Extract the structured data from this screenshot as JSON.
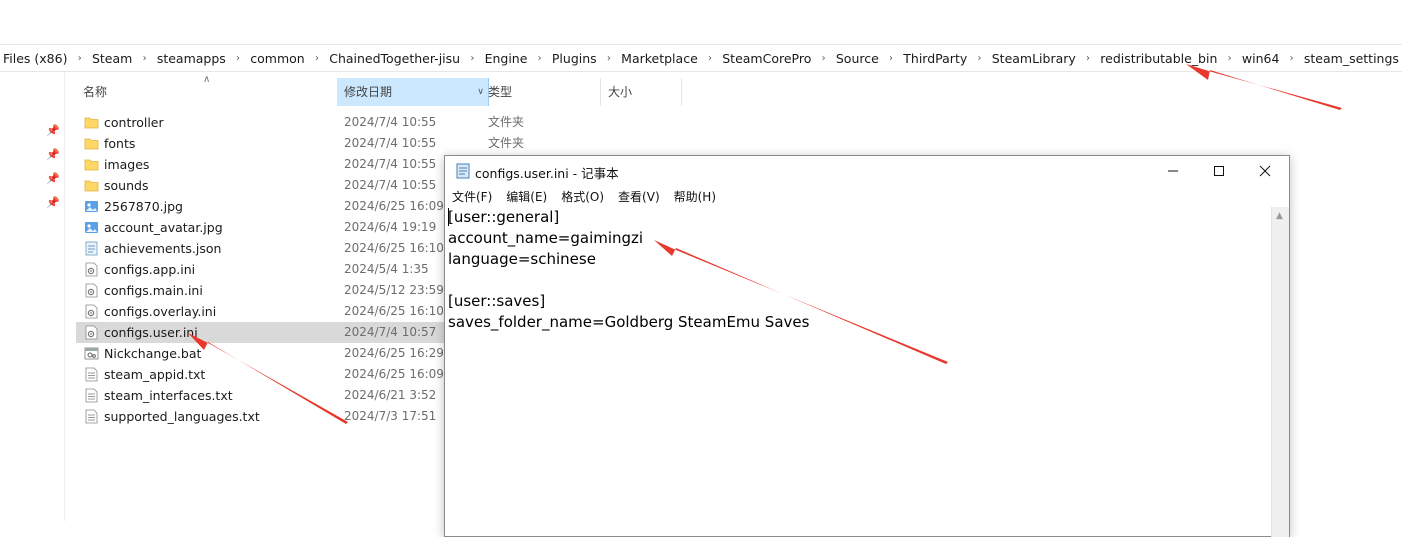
{
  "breadcrumb": [
    "Files (x86)",
    "Steam",
    "steamapps",
    "common",
    "ChainedTogether-jisu",
    "Engine",
    "Plugins",
    "Marketplace",
    "SteamCorePro",
    "Source",
    "ThirdParty",
    "SteamLibrary",
    "redistributable_bin",
    "win64",
    "steam_settings"
  ],
  "explorer": {
    "columns": {
      "name": "名称",
      "date": "修改日期",
      "type": "类型",
      "size": "大小"
    },
    "files": [
      {
        "name": "controller",
        "date": "2024/7/4 10:55",
        "type": "文件夹",
        "icon": "folder-icon"
      },
      {
        "name": "fonts",
        "date": "2024/7/4 10:55",
        "type": "文件夹",
        "icon": "folder-icon"
      },
      {
        "name": "images",
        "date": "2024/7/4 10:55",
        "type": "",
        "icon": "folder-icon"
      },
      {
        "name": "sounds",
        "date": "2024/7/4 10:55",
        "type": "",
        "icon": "folder-icon"
      },
      {
        "name": "2567870.jpg",
        "date": "2024/6/25 16:09",
        "type": "",
        "icon": "image-file-icon"
      },
      {
        "name": "account_avatar.jpg",
        "date": "2024/6/4 19:19",
        "type": "",
        "icon": "image-file-icon"
      },
      {
        "name": "achievements.json",
        "date": "2024/6/25 16:10",
        "type": "",
        "icon": "json-file-icon"
      },
      {
        "name": "configs.app.ini",
        "date": "2024/5/4 1:35",
        "type": "",
        "icon": "settings-file-icon"
      },
      {
        "name": "configs.main.ini",
        "date": "2024/5/12 23:59",
        "type": "",
        "icon": "settings-file-icon"
      },
      {
        "name": "configs.overlay.ini",
        "date": "2024/6/25 16:10",
        "type": "",
        "icon": "settings-file-icon"
      },
      {
        "name": "configs.user.ini",
        "date": "2024/7/4 10:57",
        "type": "",
        "icon": "settings-file-icon",
        "selected": true
      },
      {
        "name": "Nickchange.bat",
        "date": "2024/6/25 16:29",
        "type": "",
        "icon": "batch-file-icon"
      },
      {
        "name": "steam_appid.txt",
        "date": "2024/6/25 16:09",
        "type": "",
        "icon": "text-file-icon"
      },
      {
        "name": "steam_interfaces.txt",
        "date": "2024/6/21 3:52",
        "type": "",
        "icon": "text-file-icon"
      },
      {
        "name": "supported_languages.txt",
        "date": "2024/7/3 17:51",
        "type": "",
        "icon": "text-file-icon"
      }
    ]
  },
  "notepad": {
    "title": "configs.user.ini - 记事本",
    "menu": [
      "文件(F)",
      "编辑(E)",
      "格式(O)",
      "查看(V)",
      "帮助(H)"
    ],
    "content": "[user::general]\naccount_name=gaimingzi\nlanguage=schinese\n\n[user::saves]\nsaves_folder_name=Goldberg SteamEmu Saves"
  },
  "colors": {
    "annotation_arrow": "#e8382c",
    "header_selected": "#cce8ff",
    "row_selected": "#d9d9d9"
  }
}
